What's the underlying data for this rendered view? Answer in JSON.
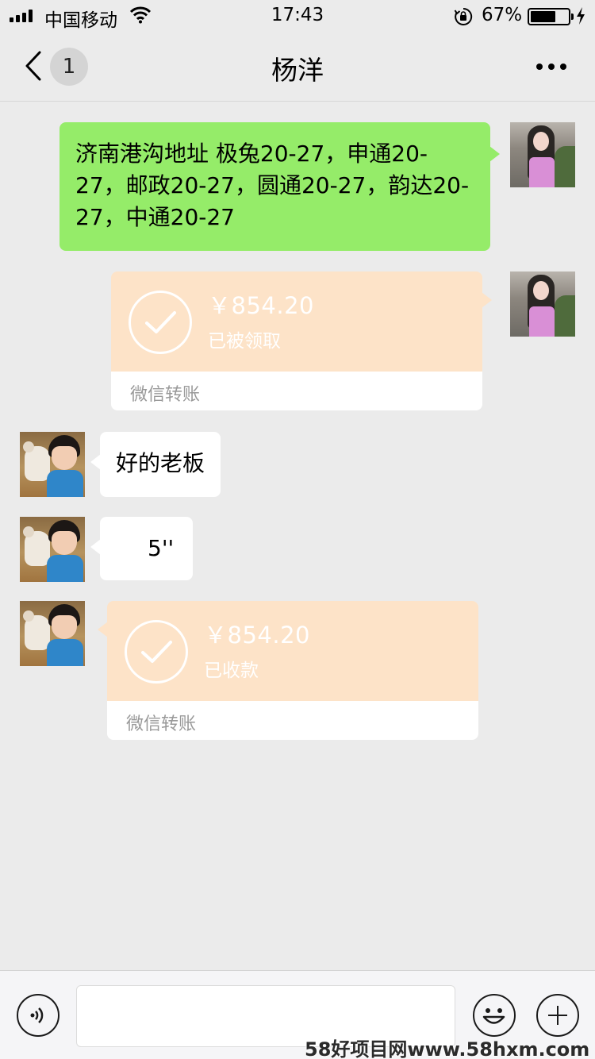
{
  "status_bar": {
    "carrier": "中国移动",
    "time": "17:43",
    "battery_percent_text": "67%",
    "battery_level": 0.67
  },
  "nav": {
    "unread_count": "1",
    "title": "杨洋"
  },
  "messages": [
    {
      "side": "right",
      "type": "text",
      "text": "济南港沟地址 极兔20-27，申通20-27，邮政20-27，圆通20-27，韵达20-27，中通20-27"
    },
    {
      "side": "right",
      "type": "transfer",
      "amount": "￥854.20",
      "status": "已被领取",
      "label": "微信转账"
    },
    {
      "side": "left",
      "type": "text",
      "text": "好的老板"
    },
    {
      "side": "left",
      "type": "voice",
      "text": "5''"
    },
    {
      "side": "left",
      "type": "transfer",
      "amount": "￥854.20",
      "status": "已收款",
      "label": "微信转账"
    }
  ],
  "input_bar": {
    "placeholder": ""
  },
  "watermark": "58好项目网www.58hxm.com",
  "colors": {
    "background": "#ebebeb",
    "sent_bubble": "#95ec69",
    "transfer_card": "#fde3c8"
  },
  "icons": [
    "signal-icon",
    "wifi-icon",
    "rotation-lock-icon",
    "battery-icon",
    "charging-bolt-icon",
    "back-chevron-icon",
    "more-dots-icon",
    "checkmark-icon",
    "voice-icon",
    "emoji-icon",
    "plus-icon"
  ]
}
